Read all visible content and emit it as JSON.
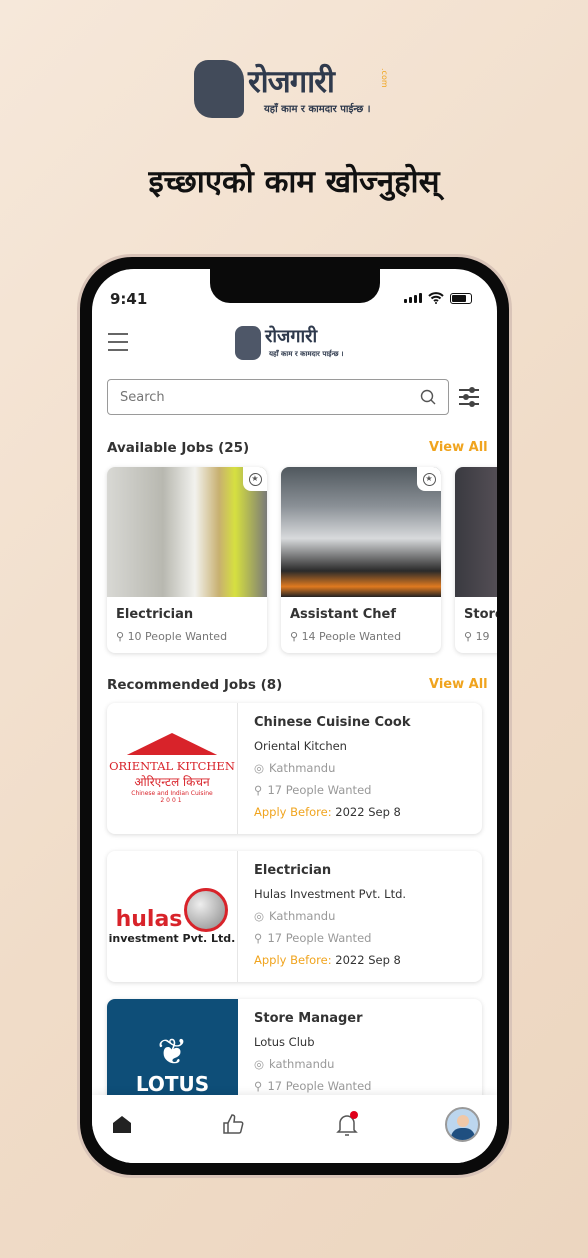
{
  "brand": {
    "name": "रोजगारी",
    "domain_suffix": ".com",
    "tagline": "यहाँ काम र कामदार पाईन्छ ।"
  },
  "headline": "इच्छाएको काम खोज्नुहोस्",
  "status_bar": {
    "time": "9:41"
  },
  "search": {
    "placeholder": "Search"
  },
  "available_jobs": {
    "title": "Available Jobs (25)",
    "view_all": "View All",
    "items": [
      {
        "title": "Electrician",
        "people": "10 People Wanted"
      },
      {
        "title": "Assistant Chef",
        "people": "14 People Wanted"
      },
      {
        "title": "Store",
        "people": "19"
      }
    ]
  },
  "recommended_jobs": {
    "title": "Recommended Jobs (8)",
    "view_all": "View All",
    "apply_label": "Apply Before:",
    "items": [
      {
        "title": "Chinese Cuisine Cook",
        "company": "Oriental Kitchen",
        "location": "Kathmandu",
        "people": "17 People Wanted",
        "deadline": "2022 Sep 8",
        "logo_text": "ORIENTAL KITCHEN",
        "logo_sub": "ओरिएन्टल किचन",
        "logo_sub2": "Chinese and Indian Cuisine",
        "logo_year": "2001"
      },
      {
        "title": "Electrician",
        "company": "Hulas Investment Pvt. Ltd.",
        "location": "Kathmandu",
        "people": "17 People Wanted",
        "deadline": "2022 Sep 8",
        "logo_text": "hulas",
        "logo_sub": "investment Pvt. Ltd."
      },
      {
        "title": "Store Manager",
        "company": "Lotus Club",
        "location": "kathmandu",
        "people": "17 People Wanted",
        "logo_text": "LOTUS"
      }
    ]
  },
  "nav": {
    "items": [
      "home",
      "like",
      "notifications",
      "profile"
    ]
  },
  "colors": {
    "accent": "#f0a41e",
    "brand": "#2f3a4d",
    "notification_dot": "#e0001a"
  }
}
